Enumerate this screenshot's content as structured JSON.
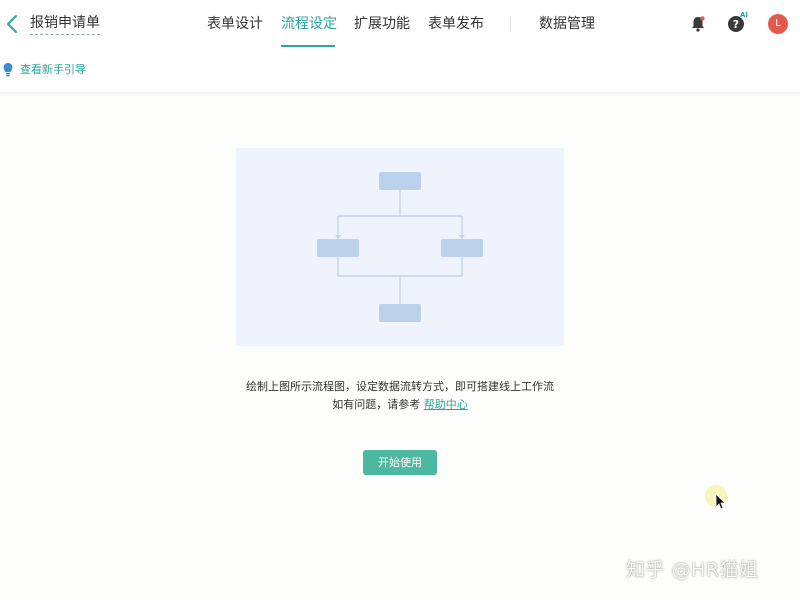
{
  "header": {
    "back_icon": "chevron-left-icon",
    "title": "报销申请单",
    "tabs": [
      {
        "label": "表单设计",
        "active": false
      },
      {
        "label": "流程设定",
        "active": true
      },
      {
        "label": "扩展功能",
        "active": false
      },
      {
        "label": "表单发布",
        "active": false
      },
      {
        "label": "数据管理",
        "active": false
      }
    ],
    "notification_icon": "bell-icon",
    "help_icon": "question-circle-icon",
    "help_badge": "AI",
    "avatar_letter": "L",
    "accent_color": "#2aa59a",
    "avatar_color": "#e05a4e"
  },
  "guide": {
    "icon": "lightbulb-icon",
    "label": "查看新手引导"
  },
  "main": {
    "illustration": "flowchart-illustration",
    "description_line1": "绘制上图所示流程图，设定数据流转方式，即可搭建线上工作流",
    "description_line2_prefix": "如有问题，请参考",
    "help_link": "帮助中心",
    "start_button": "开始使用",
    "button_color": "#4cb8a0"
  },
  "watermark": "知乎 @HR猫姐"
}
